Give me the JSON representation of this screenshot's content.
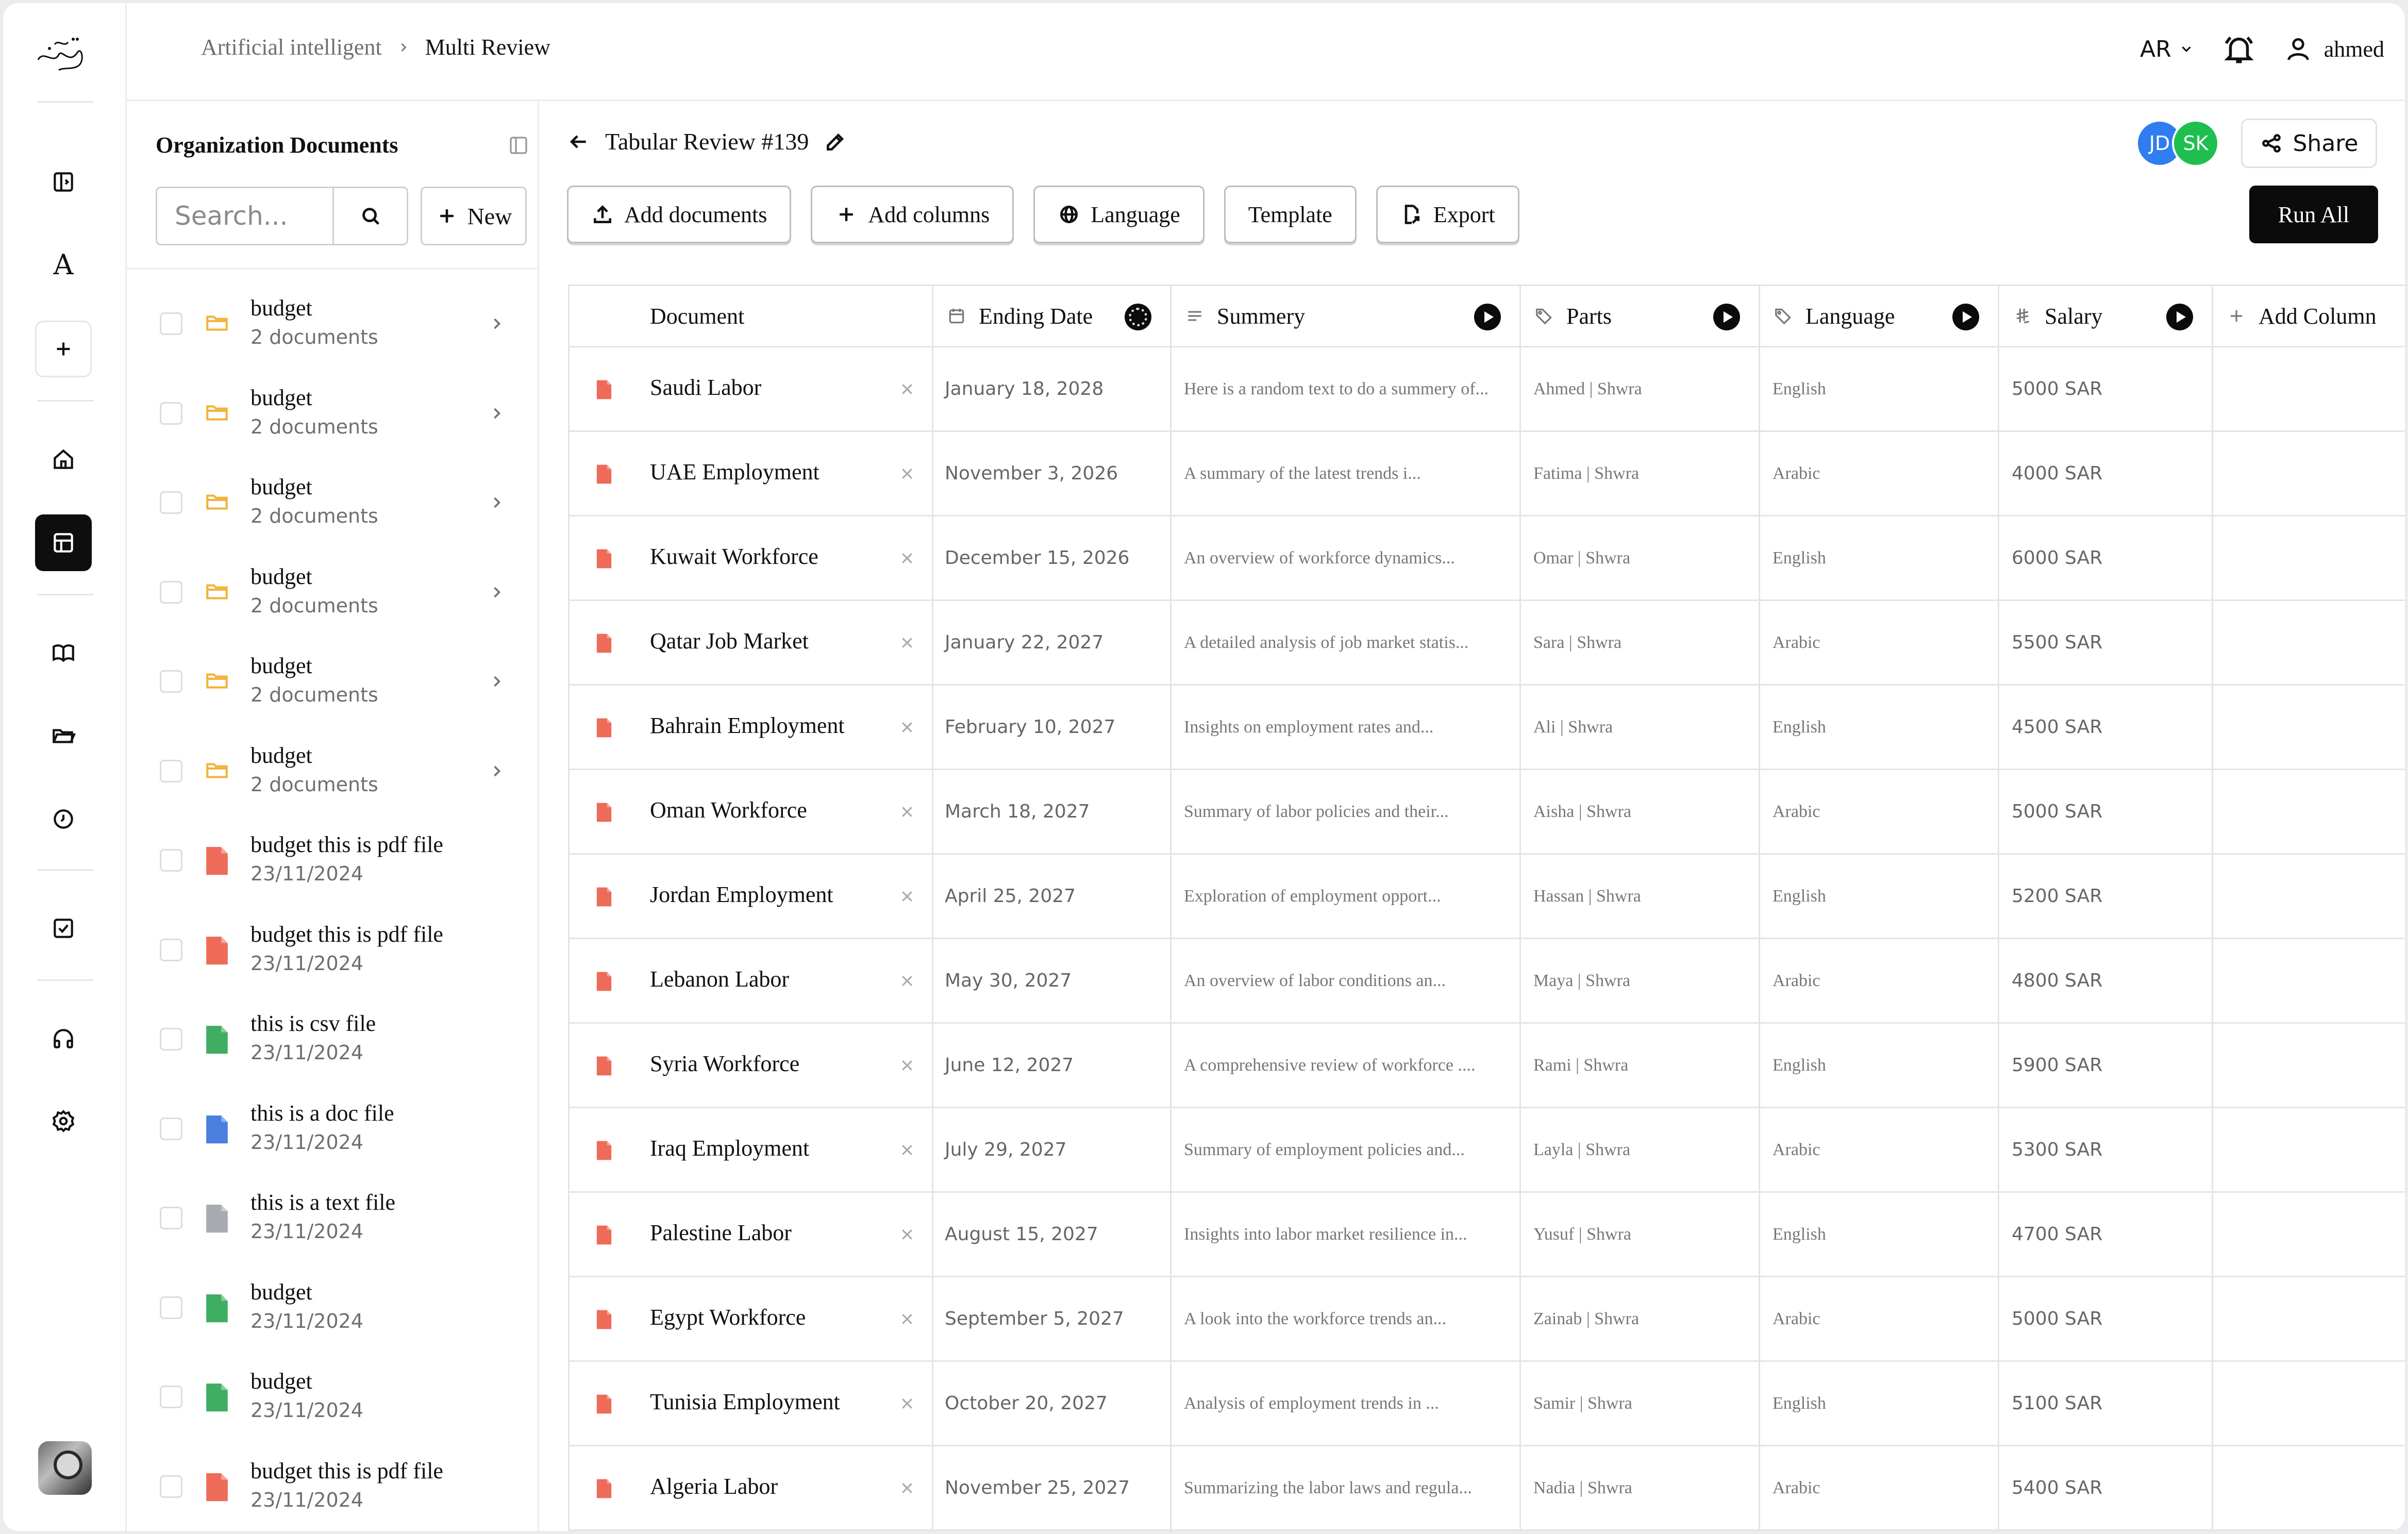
{
  "breadcrumb": {
    "parent": "Artificial intelligent",
    "current": "Multi Review"
  },
  "topbar": {
    "language": "AR",
    "user": "ahmed"
  },
  "docs_panel": {
    "title": "Organization Documents",
    "search_placeholder": "Search...",
    "new_label": "New",
    "items": [
      {
        "name": "budget",
        "sub": "2 documents",
        "type": "folder"
      },
      {
        "name": "budget",
        "sub": "2 documents",
        "type": "folder"
      },
      {
        "name": "budget",
        "sub": "2 documents",
        "type": "folder"
      },
      {
        "name": "budget",
        "sub": "2 documents",
        "type": "folder"
      },
      {
        "name": "budget",
        "sub": "2 documents",
        "type": "folder"
      },
      {
        "name": "budget",
        "sub": "2 documents",
        "type": "folder"
      },
      {
        "name": "budget this is pdf file",
        "sub": "23/11/2024",
        "type": "pdf"
      },
      {
        "name": "budget this is pdf file",
        "sub": "23/11/2024",
        "type": "pdf"
      },
      {
        "name": "this is csv file",
        "sub": "23/11/2024",
        "type": "csv"
      },
      {
        "name": "this is a doc file",
        "sub": "23/11/2024",
        "type": "doc"
      },
      {
        "name": "this is a text file",
        "sub": "23/11/2024",
        "type": "txt"
      },
      {
        "name": "budget",
        "sub": "23/11/2024",
        "type": "xlsx"
      },
      {
        "name": "budget",
        "sub": "23/11/2024",
        "type": "xls"
      },
      {
        "name": "budget this is pdf file",
        "sub": "23/11/2024",
        "type": "ppt"
      }
    ]
  },
  "review": {
    "title": "Tabular Review #139",
    "avatars": [
      "JD",
      "SK"
    ],
    "share_label": "Share",
    "actions": {
      "add_documents": "Add documents",
      "add_columns": "Add columns",
      "language": "Language",
      "template": "Template",
      "export": "Export"
    },
    "run_all": "Run All"
  },
  "table": {
    "columns": {
      "document": "Document",
      "ending_date": "Ending Date",
      "summary": "Summery",
      "parts": "Parts",
      "language": "Language",
      "salary": "Salary",
      "add_column": "Add Column"
    },
    "rows": [
      {
        "document": "Saudi Labor",
        "date": "January 18, 2028",
        "summary": "Here is a random text to do a summery of...",
        "parts": "Ahmed | Shwra",
        "language": "English",
        "salary": "5000  SAR"
      },
      {
        "document": "UAE Employment",
        "date": "November 3, 2026",
        "summary": "A summary of the latest trends i...",
        "parts": "Fatima | Shwra",
        "language": "Arabic",
        "salary": "4000 SAR"
      },
      {
        "document": "Kuwait Workforce",
        "date": "December 15, 2026",
        "summary": "An overview of workforce dynamics...",
        "parts": "Omar | Shwra",
        "language": "English",
        "salary": "6000 SAR"
      },
      {
        "document": "Qatar Job Market",
        "date": "January 22, 2027",
        "summary": "A detailed analysis of job market statis...",
        "parts": "Sara | Shwra",
        "language": "Arabic",
        "salary": "5500 SAR"
      },
      {
        "document": "Bahrain Employment",
        "date": "February 10, 2027",
        "summary": "Insights on employment rates and...",
        "parts": "Ali | Shwra",
        "language": "English",
        "salary": "4500 SAR"
      },
      {
        "document": "Oman Workforce",
        "date": "March 18, 2027",
        "summary": "Summary of labor policies and their...",
        "parts": "Aisha | Shwra",
        "language": "Arabic",
        "salary": "5000 SAR"
      },
      {
        "document": "Jordan Employment",
        "date": "April 25, 2027",
        "summary": "Exploration of employment opport...",
        "parts": "Hassan | Shwra",
        "language": "English",
        "salary": "5200 SAR"
      },
      {
        "document": "Lebanon Labor",
        "date": "May 30, 2027",
        "summary": "An overview of labor conditions an...",
        "parts": "Maya | Shwra",
        "language": "Arabic",
        "salary": "4800 SAR"
      },
      {
        "document": "Syria Workforce",
        "date": "June 12, 2027",
        "summary": "A comprehensive review of workforce ....",
        "parts": "Rami | Shwra",
        "language": "English",
        "salary": "5900 SAR"
      },
      {
        "document": "Iraq Employment",
        "date": "July 29, 2027",
        "summary": "Summary of employment policies and...",
        "parts": "Layla | Shwra",
        "language": "Arabic",
        "salary": "5300 SAR"
      },
      {
        "document": "Palestine Labor",
        "date": "August 15, 2027",
        "summary": "Insights into labor market resilience in...",
        "parts": "Yusuf | Shwra",
        "language": "English",
        "salary": "4700 SAR"
      },
      {
        "document": "Egypt Workforce",
        "date": "September 5, 2027",
        "summary": "A look into the workforce trends an...",
        "parts": "Zainab | Shwra",
        "language": "Arabic",
        "salary": "5000 SAR"
      },
      {
        "document": "Tunisia Employment",
        "date": "October 20, 2027",
        "summary": "Analysis of employment trends in ...",
        "parts": "Samir | Shwra",
        "language": "English",
        "salary": "5100 SAR"
      },
      {
        "document": "Algeria Labor",
        "date": "November 25, 2027",
        "summary": "Summarizing the labor laws and regula...",
        "parts": "Nadia | Shwra",
        "language": "Arabic",
        "salary": "5400 SAR"
      }
    ]
  },
  "colors": {
    "folder": "#f2b33d",
    "pdf": "#ee6b5a",
    "csv": "#3fae63",
    "doc": "#4a7fe0",
    "txt": "#a7aab1",
    "xls": "#3fae63",
    "avatar_jd": "#2f7df0",
    "avatar_sk": "#1fbf4f",
    "primary": "#0b0b0b"
  }
}
